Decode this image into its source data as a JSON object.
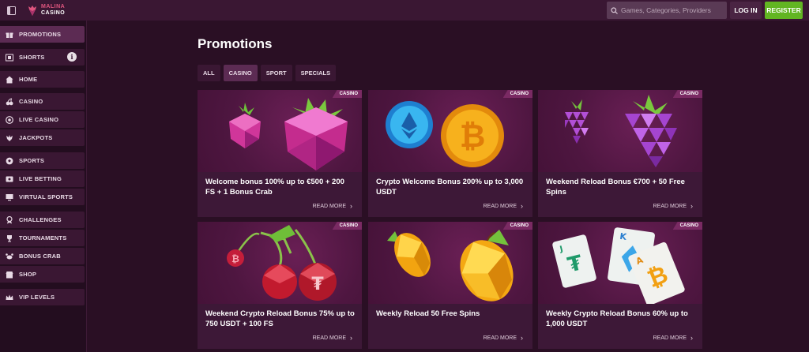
{
  "header": {
    "logo_line1": "MALINA",
    "logo_line2": "CASINO",
    "search_placeholder": "Games, Categories, Providers",
    "login_label": "LOG IN",
    "register_label": "REGISTER"
  },
  "sidebar": {
    "items": [
      {
        "label": "PROMOTIONS",
        "icon": "gift-icon",
        "active": true
      },
      {
        "label": "SHORTS",
        "icon": "film-icon"
      },
      {
        "label": "HOME",
        "icon": "home-icon"
      },
      {
        "label": "CASINO",
        "icon": "cherry-icon"
      },
      {
        "label": "LIVE CASINO",
        "icon": "chip-icon"
      },
      {
        "label": "JACKPOTS",
        "icon": "dragon-icon"
      },
      {
        "label": "SPORTS",
        "icon": "soccer-ball-icon"
      },
      {
        "label": "LIVE BETTING",
        "icon": "live-icon"
      },
      {
        "label": "VIRTUAL SPORTS",
        "icon": "screen-icon"
      },
      {
        "label": "CHALLENGES",
        "icon": "challenge-icon"
      },
      {
        "label": "TOURNAMENTS",
        "icon": "trophy-icon"
      },
      {
        "label": "BONUS CRAB",
        "icon": "crab-icon"
      },
      {
        "label": "SHOP",
        "icon": "shop-icon"
      },
      {
        "label": "VIP LEVELS",
        "icon": "crown-icon"
      }
    ],
    "shorts_info": "i"
  },
  "main": {
    "title": "Promotions",
    "tabs": [
      {
        "label": "ALL"
      },
      {
        "label": "CASINO",
        "active": true
      },
      {
        "label": "SPORT"
      },
      {
        "label": "SPECIALS"
      }
    ],
    "cards": [
      {
        "badge": "CASINO",
        "title": "Welcome bonus 100% up to €500 + 200 FS + 1 Bonus Crab",
        "more": "READ MORE",
        "art": "raspberries"
      },
      {
        "badge": "CASINO",
        "title": "Crypto Welcome Bonus 200% up to 3,000 USDT",
        "more": "READ MORE",
        "art": "crypto-coins"
      },
      {
        "badge": "CASINO",
        "title": "Weekend Reload Bonus €700 + 50 Free Spins",
        "more": "READ MORE",
        "art": "grapes"
      },
      {
        "badge": "CASINO",
        "title": "Weekend Crypto Reload Bonus 75% up to 750 USDT + 100 FS",
        "more": "READ MORE",
        "art": "cherries"
      },
      {
        "badge": "CASINO",
        "title": "Weekly Reload 50 Free Spins",
        "more": "READ MORE",
        "art": "lemons"
      },
      {
        "badge": "CASINO",
        "title": "Weekly Crypto Reload Bonus 60% up to 1,000 USDT",
        "more": "READ MORE",
        "art": "cards"
      }
    ]
  },
  "colors": {
    "background": "#2a0f24",
    "panel": "#3a1733",
    "active": "#5c2b53",
    "register": "#62b522",
    "badge": "#7a2a63"
  }
}
